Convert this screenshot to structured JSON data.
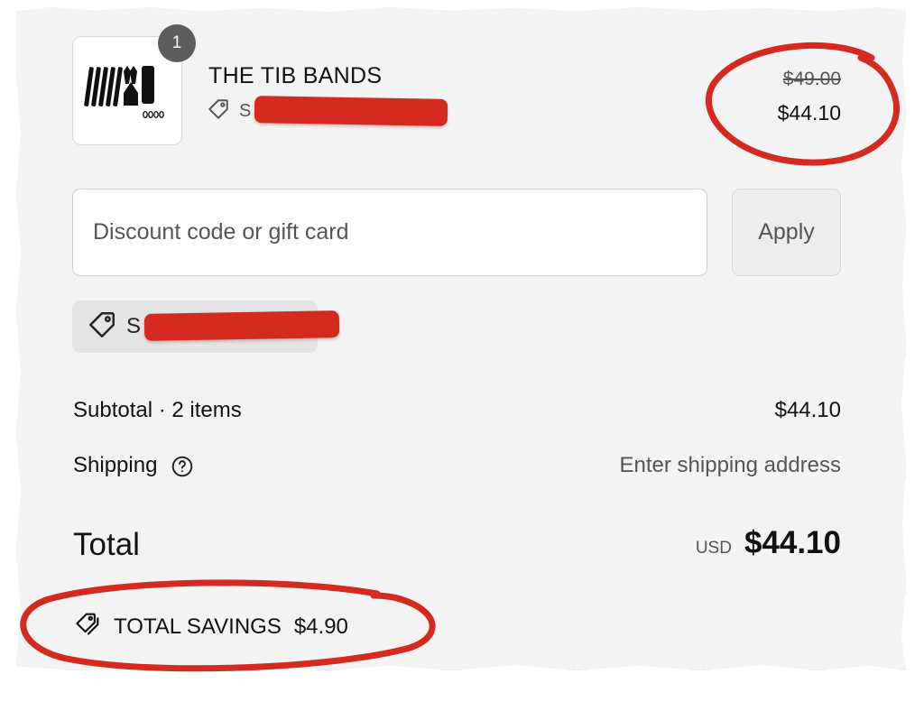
{
  "cart": {
    "item": {
      "quantity": "1",
      "title": "THE TIB BANDS",
      "discount_tag_visible": "S",
      "price_original": "$49.00",
      "price_current": "$44.10"
    },
    "discount": {
      "placeholder": "Discount code or gift card",
      "apply_label": "Apply",
      "applied_chip_visible": "S"
    },
    "summary": {
      "subtotal_label": "Subtotal · 2 items",
      "subtotal_value": "$44.10",
      "shipping_label": "Shipping",
      "shipping_value": "Enter shipping address",
      "total_label": "Total",
      "total_currency": "USD",
      "total_value": "$44.10",
      "savings_label": "TOTAL SAVINGS",
      "savings_value": "$4.90"
    }
  },
  "annotations": {
    "marker_color": "#d42a1f"
  },
  "icons": [
    "tag-icon",
    "help-circle-icon",
    "double-tag-icon"
  ]
}
